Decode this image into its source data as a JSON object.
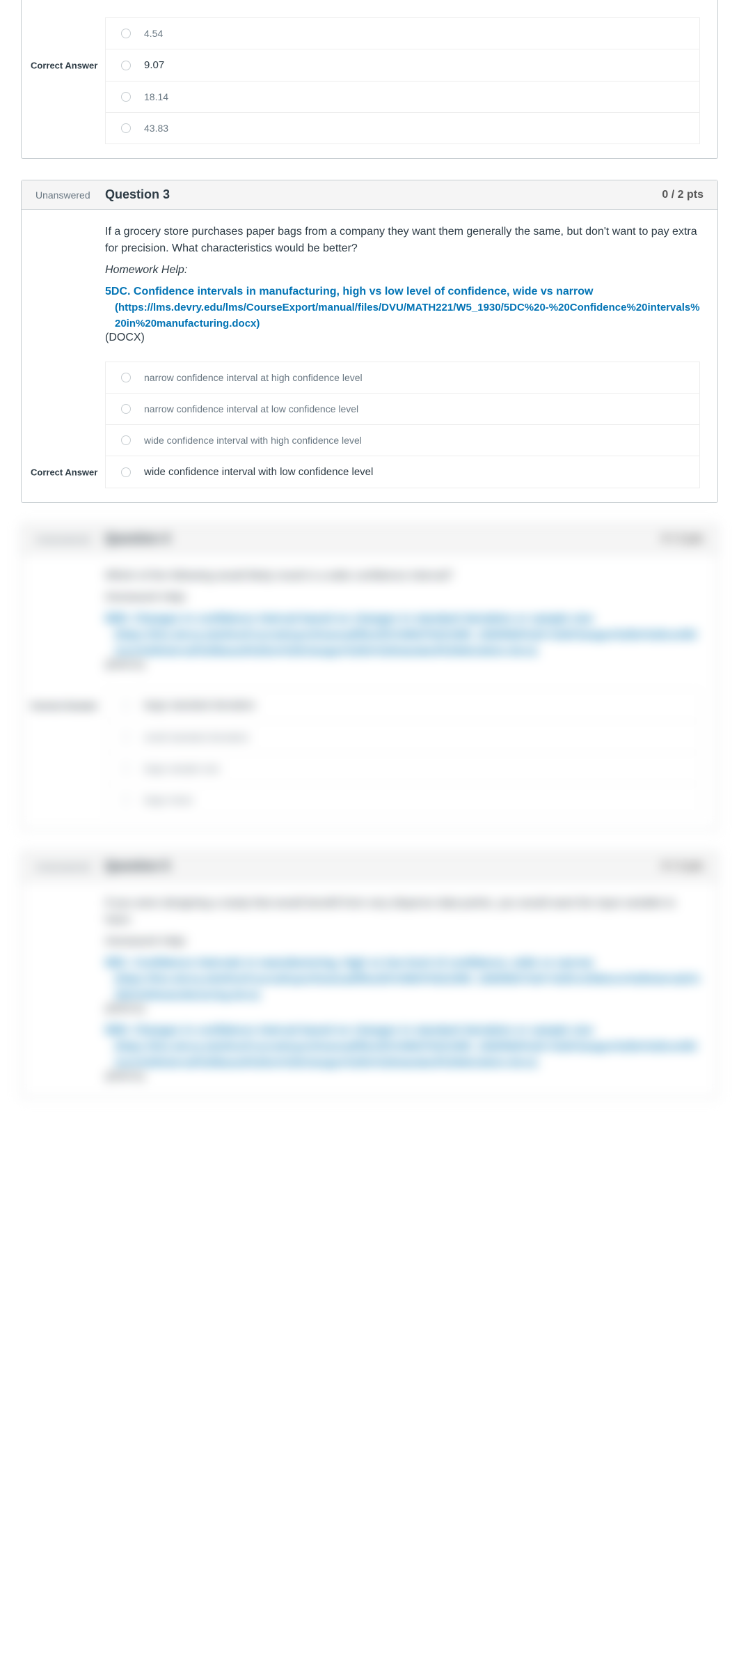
{
  "q2_partial": {
    "correct_label": "Correct Answer",
    "options": [
      {
        "text": "4.54",
        "correct": false
      },
      {
        "text": "9.07",
        "correct": true
      },
      {
        "text": "18.14",
        "correct": false
      },
      {
        "text": "43.83",
        "correct": false
      }
    ]
  },
  "q3": {
    "status": "Unanswered",
    "title": "Question 3",
    "points": "0 / 2 pts",
    "prompt": "If a grocery store purchases paper bags from a company they want them generally the same, but don't want to pay extra for precision. What characteristics would be better?",
    "homework_help_label": "Homework Help:",
    "link_title": "5DC. Confidence intervals in manufacturing, high vs low level of confidence, wide vs narrow",
    "link_href_text": "(https://lms.devry.edu/lms/CourseExport/manual/files/DVU/MATH221/W5_1930/5DC%20-%20Confidence%20intervals%20in%20manufacturing.docx)",
    "link_suffix": " (DOCX)",
    "correct_label": "Correct Answer",
    "options": [
      {
        "text": "narrow confidence interval at high confidence level",
        "correct": false
      },
      {
        "text": "narrow confidence interval at low confidence level",
        "correct": false
      },
      {
        "text": "wide confidence interval with high confidence level",
        "correct": false
      },
      {
        "text": "wide confidence interval with low confidence level",
        "correct": true
      }
    ]
  },
  "q4": {
    "status": "Unanswered",
    "title": "Question 4",
    "points": "0 / 2 pts",
    "prompt": "Which of the following would likely result in a wide confidence interval?",
    "homework_help_label": "Homework Help:",
    "link_title": "5DD. Changes in confidence interval based on changes in standard deviation or sample size",
    "link_href_text": "(https://lms.devry.edu/lms/CourseExport/manual/files/DVU/MATH221/W5_1930/5DD%20-%20Changes%20in%20confidence%20interval%20based%20on%20changes%20in%20standard%20deviation.docx)",
    "link_suffix": " (DOCX)",
    "correct_label": "Correct Answer",
    "options": [
      {
        "text": "large standard deviation",
        "correct": true
      },
      {
        "text": "small standard deviation",
        "correct": false
      },
      {
        "text": "large sample size",
        "correct": false
      },
      {
        "text": "large mean",
        "correct": false
      }
    ]
  },
  "q5": {
    "status": "Unanswered",
    "title": "Question 5",
    "points": "0 / 2 pts",
    "prompt": "If you were designing a study that would benefit from very disperse data points, you would want the input variable to have:",
    "homework_help_label": "Homework Help:",
    "link1_title": "5DC. Confidence intervals in manufacturing, high vs low level of confidence, wide vs narrow",
    "link1_href_text": "(https://lms.devry.edu/lms/CourseExport/manual/files/DVU/MATH221/W5_1930/5DC%20-%20Confidence%20intervals%20in%20manufacturing.docx)",
    "link1_suffix": " (DOCX)",
    "link2_title": "5DD. Changes in confidence interval based on changes in standard deviation or sample size",
    "link2_href_text": "(https://lms.devry.edu/lms/CourseExport/manual/files/DVU/MATH221/W5_1930/5DD%20-%20Changes%20in%20confidence%20interval%20based%20on%20changes%20in%20standard%20deviation.docx)",
    "link2_suffix": " (DOCX)"
  }
}
